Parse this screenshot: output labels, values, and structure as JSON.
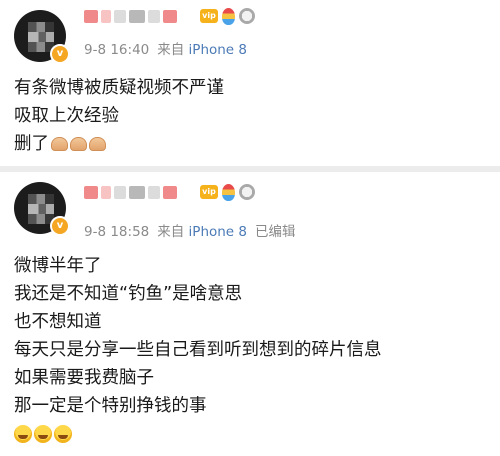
{
  "posts": [
    {
      "time": "9-8 16:40",
      "source_prefix": "来自",
      "device": "iPhone 8",
      "edited": "",
      "lines": [
        "有条微博被质疑视频不严谨",
        "吸取上次经验",
        "删了"
      ],
      "trailing_emoji": "pray-icon x3"
    },
    {
      "time": "9-8 18:58",
      "source_prefix": "来自",
      "device": "iPhone 8",
      "edited": "已编辑",
      "lines": [
        "微博半年了",
        "我还是不知道“钓鱼”是啥意思",
        "也不想知道",
        "每天只是分享一些自己看到听到想到的碎片信息",
        "如果需要我费脑子",
        "那一定是个特别挣钱的事"
      ],
      "trailing_emoji": "laugh-cry-icon x3"
    }
  ],
  "verified_badge_letter": "v",
  "medal_vip_label": "vip",
  "colors": {
    "background": "#ececec",
    "card": "#ffffff",
    "text": "#1a1a1a",
    "meta": "#8a8a8a",
    "device": "#4c7bb6",
    "verified": "#f5a623"
  }
}
